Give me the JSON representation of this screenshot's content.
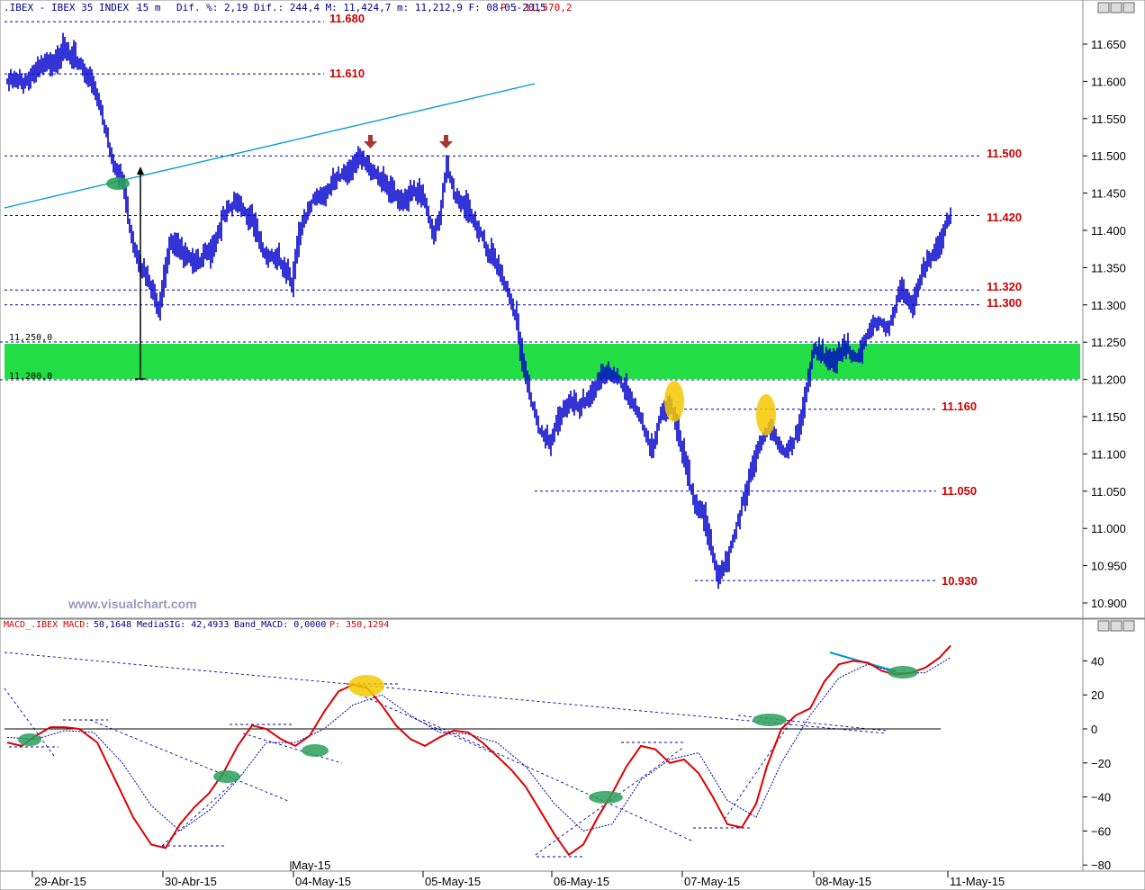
{
  "header": {
    "symbol": ".IBEX - IBEX 35 INDEX -",
    "timeframe": "15 m",
    "stats": "Dif. %: 2,19 Dif.: 244,4 M: 11,424,7 m: 11,212,9 F: 08-05-2015",
    "p_label": "P : 11,570,2"
  },
  "watermark": "www.visualchart.com",
  "price_axis": {
    "min": 10880,
    "max": 11690,
    "ticks": [
      "11.650",
      "11.600",
      "11.550",
      "11.500",
      "11.450",
      "11.400",
      "11.350",
      "11.300",
      "11.250",
      "11.200",
      "11.150",
      "11.100",
      "11.050",
      "11.000",
      "10.950",
      "10.900"
    ]
  },
  "levels": [
    "11.680",
    "11.610",
    "11.500",
    "11.420",
    "11.320",
    "11.300",
    "11.160",
    "11.050",
    "10.930"
  ],
  "zone_labels": {
    "top": "11,250,0",
    "bottom": "11,200,0"
  },
  "macd": {
    "label_name": "MACD_.IBEX MACD:",
    "label_value": "50,1648",
    "label_sig": "MediaSIG: 42,4933",
    "label_band": "Band_MACD: 0,0000",
    "label_p": "P: 350,1294",
    "ticks": [
      "40",
      "20",
      "0",
      "−20",
      "−40",
      "−60",
      "−80"
    ]
  },
  "x_axis": {
    "labels": [
      "29-Abr-15",
      "30-Abr-15",
      "04-May-15",
      "05-May-15",
      "06-May-15",
      "07-May-15",
      "08-May-15",
      "11-May-15"
    ],
    "month_label": "May-15"
  },
  "colors": {
    "bars": "#0000cc",
    "level_line": "#0000aa",
    "zone": "#22dd44",
    "macd": "#dd0000",
    "signal": "#0000aa",
    "trend": "#0099cc",
    "arrow": "#aa3333",
    "highlight_yellow": "#f5c800",
    "highlight_green": "#2aa05a"
  },
  "chart_data": {
    "type": "bar",
    "title": ".IBEX - IBEX 35 INDEX - 15 m",
    "price_range": [
      10880,
      11690
    ],
    "horizontal_levels": [
      11680,
      11610,
      11500,
      11420,
      11320,
      11300,
      11160,
      11050,
      10930
    ],
    "support_zone": [
      11200,
      11250
    ],
    "price_path": [
      [
        0,
        11600
      ],
      [
        10,
        11600
      ],
      [
        20,
        11620
      ],
      [
        30,
        11640
      ],
      [
        40,
        11625
      ],
      [
        46,
        11600
      ],
      [
        52,
        11560
      ],
      [
        56,
        11520
      ],
      [
        60,
        11480
      ],
      [
        62,
        11470
      ],
      [
        64,
        11460
      ],
      [
        70,
        11380
      ],
      [
        78,
        11330
      ],
      [
        84,
        11300
      ],
      [
        90,
        11380
      ],
      [
        100,
        11370
      ],
      [
        106,
        11355
      ],
      [
        114,
        11380
      ],
      [
        120,
        11420
      ],
      [
        128,
        11440
      ],
      [
        136,
        11410
      ],
      [
        142,
        11370
      ],
      [
        150,
        11360
      ],
      [
        158,
        11330
      ],
      [
        162,
        11400
      ],
      [
        170,
        11440
      ],
      [
        180,
        11460
      ],
      [
        188,
        11480
      ],
      [
        196,
        11495
      ],
      [
        204,
        11480
      ],
      [
        212,
        11450
      ],
      [
        218,
        11440
      ],
      [
        226,
        11450
      ],
      [
        232,
        11440
      ],
      [
        236,
        11400
      ],
      [
        240,
        11410
      ],
      [
        244,
        11490
      ],
      [
        248,
        11450
      ],
      [
        254,
        11430
      ],
      [
        262,
        11400
      ],
      [
        270,
        11360
      ],
      [
        278,
        11320
      ],
      [
        282,
        11290
      ],
      [
        286,
        11220
      ],
      [
        290,
        11180
      ],
      [
        296,
        11130
      ],
      [
        302,
        11110
      ],
      [
        306,
        11150
      ],
      [
        312,
        11170
      ],
      [
        318,
        11160
      ],
      [
        326,
        11190
      ],
      [
        334,
        11210
      ],
      [
        340,
        11200
      ],
      [
        346,
        11170
      ],
      [
        352,
        11150
      ],
      [
        358,
        11100
      ],
      [
        364,
        11160
      ],
      [
        368,
        11170
      ],
      [
        372,
        11130
      ],
      [
        376,
        11090
      ],
      [
        380,
        11050
      ],
      [
        386,
        11020
      ],
      [
        390,
        10980
      ],
      [
        394,
        10940
      ],
      [
        398,
        10950
      ],
      [
        404,
        10990
      ],
      [
        408,
        11030
      ],
      [
        412,
        11070
      ],
      [
        416,
        11100
      ],
      [
        420,
        11120
      ],
      [
        424,
        11140
      ],
      [
        428,
        11110
      ],
      [
        432,
        11100
      ],
      [
        436,
        11110
      ],
      [
        440,
        11140
      ],
      [
        444,
        11190
      ],
      [
        448,
        11240
      ],
      [
        454,
        11230
      ],
      [
        460,
        11230
      ],
      [
        466,
        11240
      ],
      [
        472,
        11230
      ],
      [
        478,
        11260
      ],
      [
        484,
        11280
      ],
      [
        490,
        11270
      ],
      [
        496,
        11320
      ],
      [
        502,
        11300
      ],
      [
        508,
        11340
      ],
      [
        514,
        11370
      ],
      [
        520,
        11400
      ],
      [
        524,
        11420
      ]
    ],
    "macd_range": [
      -80,
      50
    ],
    "macd_series": {
      "name": "MACD",
      "values": [
        [
          0,
          -8
        ],
        [
          8,
          -10
        ],
        [
          16,
          -4
        ],
        [
          24,
          1
        ],
        [
          32,
          1
        ],
        [
          40,
          0
        ],
        [
          50,
          -8
        ],
        [
          60,
          -30
        ],
        [
          70,
          -52
        ],
        [
          80,
          -68
        ],
        [
          88,
          -70
        ],
        [
          96,
          -56
        ],
        [
          104,
          -46
        ],
        [
          112,
          -38
        ],
        [
          120,
          -26
        ],
        [
          128,
          -10
        ],
        [
          136,
          2
        ],
        [
          144,
          0
        ],
        [
          152,
          -6
        ],
        [
          160,
          -10
        ],
        [
          168,
          -4
        ],
        [
          176,
          10
        ],
        [
          184,
          22
        ],
        [
          192,
          26
        ],
        [
          200,
          24
        ],
        [
          208,
          14
        ],
        [
          216,
          2
        ],
        [
          224,
          -6
        ],
        [
          232,
          -10
        ],
        [
          240,
          -5
        ],
        [
          248,
          -1
        ],
        [
          256,
          -2
        ],
        [
          264,
          -8
        ],
        [
          272,
          -16
        ],
        [
          280,
          -24
        ],
        [
          288,
          -34
        ],
        [
          296,
          -48
        ],
        [
          304,
          -62
        ],
        [
          312,
          -74
        ],
        [
          320,
          -68
        ],
        [
          328,
          -52
        ],
        [
          336,
          -38
        ],
        [
          344,
          -22
        ],
        [
          352,
          -10
        ],
        [
          360,
          -12
        ],
        [
          368,
          -20
        ],
        [
          376,
          -18
        ],
        [
          384,
          -26
        ],
        [
          392,
          -40
        ],
        [
          400,
          -56
        ],
        [
          408,
          -58
        ],
        [
          416,
          -44
        ],
        [
          422,
          -22
        ],
        [
          430,
          0
        ],
        [
          438,
          8
        ],
        [
          446,
          12
        ],
        [
          454,
          28
        ],
        [
          462,
          38
        ],
        [
          470,
          40
        ],
        [
          478,
          39
        ],
        [
          486,
          34
        ],
        [
          494,
          32
        ],
        [
          502,
          33
        ],
        [
          510,
          36
        ],
        [
          518,
          42
        ],
        [
          524,
          49
        ]
      ]
    },
    "signal_series": {
      "name": "MediaSIG",
      "values": [
        [
          0,
          -5
        ],
        [
          16,
          -6
        ],
        [
          32,
          -1
        ],
        [
          48,
          -2
        ],
        [
          64,
          -20
        ],
        [
          80,
          -45
        ],
        [
          96,
          -60
        ],
        [
          112,
          -48
        ],
        [
          128,
          -30
        ],
        [
          144,
          -8
        ],
        [
          160,
          -8
        ],
        [
          176,
          0
        ],
        [
          192,
          14
        ],
        [
          208,
          20
        ],
        [
          224,
          8
        ],
        [
          240,
          -2
        ],
        [
          256,
          -3
        ],
        [
          272,
          -8
        ],
        [
          288,
          -22
        ],
        [
          304,
          -44
        ],
        [
          320,
          -60
        ],
        [
          336,
          -56
        ],
        [
          352,
          -30
        ],
        [
          368,
          -18
        ],
        [
          384,
          -14
        ],
        [
          400,
          -42
        ],
        [
          416,
          -52
        ],
        [
          430,
          -20
        ],
        [
          446,
          8
        ],
        [
          462,
          30
        ],
        [
          478,
          38
        ],
        [
          494,
          33
        ],
        [
          510,
          33
        ],
        [
          524,
          42
        ]
      ]
    }
  }
}
